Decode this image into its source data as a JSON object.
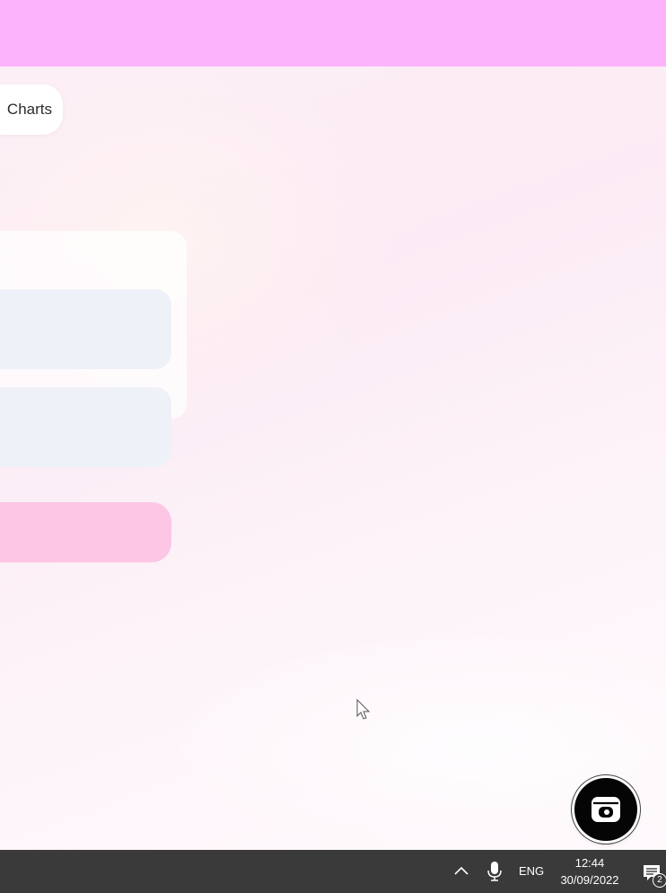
{
  "app": {
    "nav_chip_label": "Charts"
  },
  "colors": {
    "top_bar": "#fdb2fc",
    "background": "#fcebf4",
    "input_field": "#eff1f8",
    "submit_button": "#fcc6e4",
    "taskbar": "#3a3a3a"
  },
  "fab": {
    "icon": "screen-capture-icon"
  },
  "taskbar": {
    "tray_icon": "chevron-up-icon",
    "mic_icon": "microphone-icon",
    "language": "ENG",
    "time": "12:44",
    "date": "30/09/2022",
    "notifications_icon": "notifications-icon",
    "notifications_count": "2"
  }
}
